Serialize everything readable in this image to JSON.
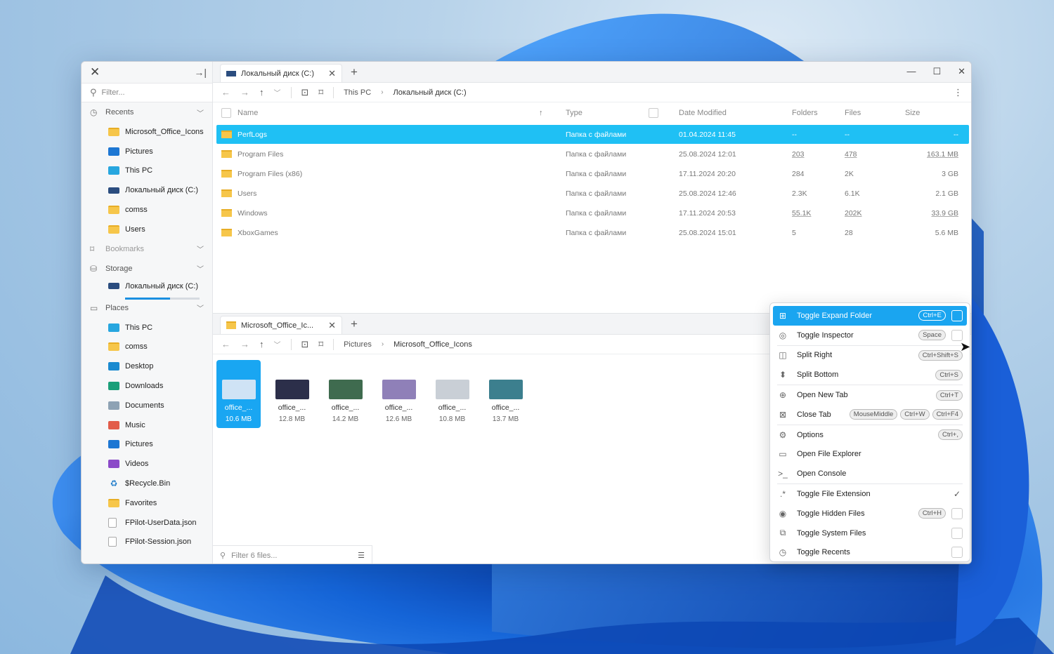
{
  "sidebar": {
    "filter_placeholder": "Filter...",
    "recents_label": "Recents",
    "recents": [
      {
        "label": "Microsoft_Office_Icons",
        "icon": "folder-icon"
      },
      {
        "label": "Pictures",
        "icon": "pictures-icon"
      },
      {
        "label": "This PC",
        "icon": "this-pc-icon"
      },
      {
        "label": "Локальный диск (C:)",
        "icon": "drive-icon"
      },
      {
        "label": "comss",
        "icon": "folder-icon"
      },
      {
        "label": "Users",
        "icon": "folder-icon"
      }
    ],
    "bookmarks_label": "Bookmarks",
    "storage_label": "Storage",
    "storage_item": "Локальный диск (C:)",
    "storage_used_fraction": 0.6,
    "places_label": "Places",
    "places": [
      {
        "label": "This PC",
        "icon": "this-pc-icon"
      },
      {
        "label": "comss",
        "icon": "folder-icon"
      },
      {
        "label": "Desktop",
        "icon": "desktop-icon"
      },
      {
        "label": "Downloads",
        "icon": "downloads-icon"
      },
      {
        "label": "Documents",
        "icon": "documents-icon"
      },
      {
        "label": "Music",
        "icon": "music-icon"
      },
      {
        "label": "Pictures",
        "icon": "pictures-icon"
      },
      {
        "label": "Videos",
        "icon": "videos-icon"
      },
      {
        "label": "$Recycle.Bin",
        "icon": "recycle-bin-icon"
      },
      {
        "label": "Favorites",
        "icon": "folder-icon"
      },
      {
        "label": "FPilot-UserData.json",
        "icon": "file-icon"
      },
      {
        "label": "FPilot-Session.json",
        "icon": "file-icon"
      }
    ]
  },
  "top": {
    "tab_label": "Локальный диск (C:)",
    "crumbs": [
      "This PC",
      "Локальный диск (C:)"
    ],
    "columns": {
      "name": "Name",
      "type": "Type",
      "date": "Date Modified",
      "folders": "Folders",
      "files": "Files",
      "size": "Size"
    },
    "rows": [
      {
        "name": "PerfLogs",
        "type": "Папка с файлами",
        "date": "01.04.2024 11:45",
        "folders": "--",
        "files": "--",
        "size": "--"
      },
      {
        "name": "Program Files",
        "type": "Папка с файлами",
        "date": "25.08.2024 12:01",
        "folders": "203",
        "files": "478",
        "size": "163.1 MB"
      },
      {
        "name": "Program Files (x86)",
        "type": "Папка с файлами",
        "date": "17.11.2024 20:20",
        "folders": "284",
        "files": "2K",
        "size": "3 GB"
      },
      {
        "name": "Users",
        "type": "Папка с файлами",
        "date": "25.08.2024 12:46",
        "folders": "2.3K",
        "files": "6.1K",
        "size": "2.1 GB"
      },
      {
        "name": "Windows",
        "type": "Папка с файлами",
        "date": "17.11.2024 20:53",
        "folders": "55.1K",
        "files": "202K",
        "size": "33.9 GB"
      },
      {
        "name": "XboxGames",
        "type": "Папка с файлами",
        "date": "25.08.2024 15:01",
        "folders": "5",
        "files": "28",
        "size": "5.6 MB"
      }
    ]
  },
  "bottom": {
    "tab_label": "Microsoft_Office_Ic...",
    "crumbs": [
      "Pictures",
      "Microsoft_Office_Icons"
    ],
    "tiles": [
      {
        "name": "office_...",
        "size": "10.6 MB",
        "color": "#cfe3f5"
      },
      {
        "name": "office_...",
        "size": "12.8 MB",
        "color": "#2c2f4a"
      },
      {
        "name": "office_...",
        "size": "14.2 MB",
        "color": "#3f6b4f"
      },
      {
        "name": "office_...",
        "size": "12.6 MB",
        "color": "#8f80b8"
      },
      {
        "name": "office_...",
        "size": "10.8 MB",
        "color": "#c9cfd6"
      },
      {
        "name": "office_...",
        "size": "13.7 MB",
        "color": "#3c7f8e"
      }
    ],
    "filter_placeholder": "Filter 6 files..."
  },
  "menu": {
    "items": [
      {
        "label": "Toggle Expand Folder",
        "keys": [
          "Ctrl+E"
        ],
        "box": true
      },
      {
        "label": "Toggle Inspector",
        "keys": [
          "Space"
        ],
        "box": true
      },
      {
        "label": "Split Right",
        "keys": [
          "Ctrl+Shift+S"
        ]
      },
      {
        "label": "Split Bottom",
        "keys": [
          "Ctrl+S"
        ]
      },
      {
        "label": "Open New Tab",
        "keys": [
          "Ctrl+T"
        ]
      },
      {
        "label": "Close Tab",
        "keys": [
          "MouseMiddle",
          "Ctrl+W",
          "Ctrl+F4"
        ]
      },
      {
        "label": "Options",
        "keys": [
          "Ctrl+,"
        ]
      },
      {
        "label": "Open File Explorer",
        "keys": []
      },
      {
        "label": "Open Console",
        "keys": []
      },
      {
        "label": "Toggle File Extension",
        "keys": []
      },
      {
        "label": "Toggle Hidden Files",
        "keys": [
          "Ctrl+H"
        ],
        "box": true
      },
      {
        "label": "Toggle System Files",
        "keys": [],
        "box": true
      },
      {
        "label": "Toggle Recents",
        "keys": [],
        "box": true
      }
    ]
  },
  "colors": {
    "accent": "#1aa5f0",
    "selection": "#1fc0f4",
    "folder": "#f6c64a"
  }
}
